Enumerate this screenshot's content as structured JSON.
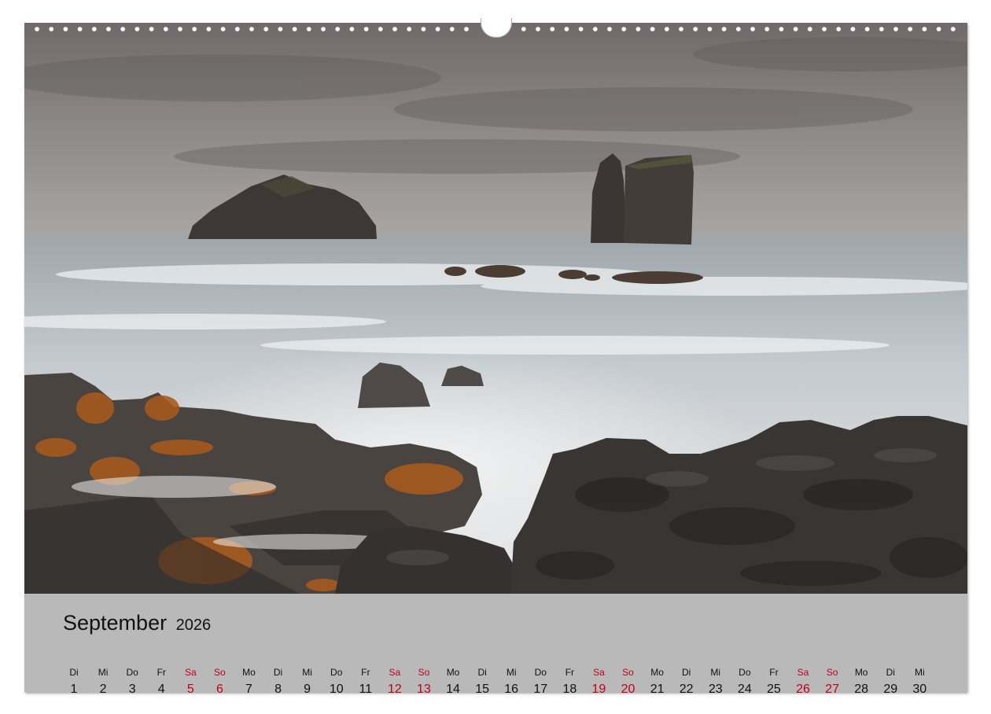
{
  "calendar": {
    "month": "September",
    "year": "2026",
    "weekend_color": "#c0001a",
    "days": [
      {
        "wd": "Di",
        "d": "1",
        "we": false
      },
      {
        "wd": "Mi",
        "d": "2",
        "we": false
      },
      {
        "wd": "Do",
        "d": "3",
        "we": false
      },
      {
        "wd": "Fr",
        "d": "4",
        "we": false
      },
      {
        "wd": "Sa",
        "d": "5",
        "we": true
      },
      {
        "wd": "So",
        "d": "6",
        "we": true
      },
      {
        "wd": "Mo",
        "d": "7",
        "we": false
      },
      {
        "wd": "Di",
        "d": "8",
        "we": false
      },
      {
        "wd": "Mi",
        "d": "9",
        "we": false
      },
      {
        "wd": "Do",
        "d": "10",
        "we": false
      },
      {
        "wd": "Fr",
        "d": "11",
        "we": false
      },
      {
        "wd": "Sa",
        "d": "12",
        "we": true
      },
      {
        "wd": "So",
        "d": "13",
        "we": true
      },
      {
        "wd": "Mo",
        "d": "14",
        "we": false
      },
      {
        "wd": "Di",
        "d": "15",
        "we": false
      },
      {
        "wd": "Mi",
        "d": "16",
        "we": false
      },
      {
        "wd": "Do",
        "d": "17",
        "we": false
      },
      {
        "wd": "Fr",
        "d": "18",
        "we": false
      },
      {
        "wd": "Sa",
        "d": "19",
        "we": true
      },
      {
        "wd": "So",
        "d": "20",
        "we": true
      },
      {
        "wd": "Mo",
        "d": "21",
        "we": false
      },
      {
        "wd": "Di",
        "d": "22",
        "we": false
      },
      {
        "wd": "Mi",
        "d": "23",
        "we": false
      },
      {
        "wd": "Do",
        "d": "24",
        "we": false
      },
      {
        "wd": "Fr",
        "d": "25",
        "we": false
      },
      {
        "wd": "Sa",
        "d": "26",
        "we": true
      },
      {
        "wd": "So",
        "d": "27",
        "we": true
      },
      {
        "wd": "Mo",
        "d": "28",
        "we": false
      },
      {
        "wd": "Di",
        "d": "29",
        "we": false
      },
      {
        "wd": "Mi",
        "d": "30",
        "we": false
      }
    ]
  },
  "photo": {
    "subject": "long-exposure-seascape-rock-stacks",
    "colors": {
      "sky": "#8a8686",
      "sea": "#c9cdd0",
      "rock": "#3a3836",
      "lichen": "#b0601e"
    }
  }
}
